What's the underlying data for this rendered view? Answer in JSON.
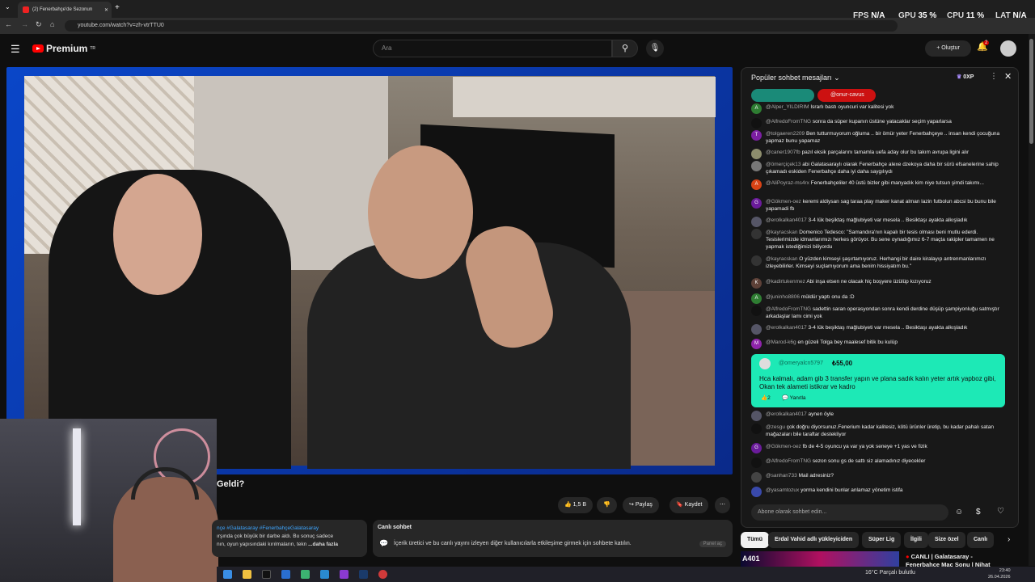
{
  "browser": {
    "tab_title": "(2) Fenerbahçe'de Sezonun",
    "url": "youtube.com/watch?v=zh-vtrTTU0",
    "perf": {
      "fps_label": "FPS",
      "fps": "N/A",
      "gpu_label": "GPU",
      "gpu": "35 %",
      "cpu_label": "CPU",
      "cpu": "11 %",
      "lat_label": "LAT",
      "lat": "N/A"
    }
  },
  "header": {
    "logo": "Premium",
    "logo_sup": "TR",
    "search_placeholder": "Ara",
    "create_label": "Oluştur",
    "notif_count": "2"
  },
  "video": {
    "title_fragment": "Geldi?",
    "like_count": "1,5 B",
    "share_label": "Paylaş",
    "save_label": "Kaydet"
  },
  "description": {
    "tags": "nçe #Galatasaray #FenerbahçeGalatasaray",
    "line1": "ırşında çok büyük bir darbe aldı. Bu sonuç sadece",
    "line2": "nın, oyun yapısındaki kırılmaların, tekn",
    "more": "...daha fazla"
  },
  "live_chat_card": {
    "title": "Canlı sohbet",
    "body": "İçerik üretici ve bu canlı yayını izleyen diğer kullanıcılarla etkileşime girmek için sohbete katılın.",
    "button": "Panel aç"
  },
  "chat": {
    "title": "Popüler sohbet mesajları",
    "xp": "0XP",
    "pinned_user": "@onur-cavus",
    "messages": [
      {
        "name": "@Alper_YILDIRIM",
        "text": "Israrlı bastı oyuncuri var kalitesi yok",
        "color": "#2e7d32",
        "initial": "A"
      },
      {
        "name": "@AlfredoFromTNG",
        "text": "sonra da süper kupanın üstüne yatacaklar seçim yaparlarsa",
        "color": "#111",
        "initial": ""
      },
      {
        "name": "@tolgaeren2209",
        "text": "Ben tutturmuyorum oğluma .. bir ömür yeter Fenerbahçeye .. insan kendi çocuğuna yapmaz bunu yapamaz",
        "color": "#7b1fa2",
        "initial": "T"
      },
      {
        "name": "@caner1907fb",
        "text": "pazıl eksik parçalarını tamamla uefa aday olur bu takım avrupa ligini alır",
        "color": "#8d8d6d",
        "initial": ""
      },
      {
        "name": "@ömerçiçek13",
        "text": "abi Galatasaraylı olarak Fenerbahçe alexe dzekoya daha bir sürü efsanelerine sahip çıkamadı eskiden Fenerbahçe daha iyi daha saygılıydı",
        "color": "#777",
        "initial": ""
      },
      {
        "name": "@AliPoyraz-ms4rx",
        "text": "Fenerbahçeliler 40 üstü bizler gibi manyadık kim niye tutsun şimdi takımı...",
        "color": "#d84315",
        "initial": "A"
      },
      {
        "name": "@Gökmen-oez",
        "text": "keremi aldiysan sag taraa play maker kanat alman lazin futbolun abcsi bu bunu bile yapamadi fb",
        "color": "#6a1b9a",
        "initial": "G"
      },
      {
        "name": "@erolkalkan4017",
        "text": "3-4 lük beşiktaş mağlubiyeti var mesela .. Besiktaşı ayakta alkışladık",
        "color": "#556",
        "initial": ""
      },
      {
        "name": "@kayracskan",
        "text": "Domenico Tedesco: \"Samandıra'nın kapalı bir tesis olması beni mutlu ederdi. Tesislerimizde idmanlarımızı herkes görüyor. Bu sene oynadığımız 6-7 maçta rakipler tamamen ne yapmak istediğimizi biliyordu",
        "color": "#333",
        "initial": ""
      },
      {
        "name": "@kayracskan",
        "text": "O yüzden kimseyi şaşırtamıyoruz. Herhangi bir daire kiralayıp antrenmanlarımızı izleyebilirler. Kimseyi suçlamıyorum ama benim hissiyatım bu.\"",
        "color": "#333",
        "initial": ""
      },
      {
        "name": "@kadirtukenmez",
        "text": "Abi inşa etsen ne olacak hiç boşyere üzülüp kızıyoruz",
        "color": "#5d4037",
        "initial": "K"
      },
      {
        "name": "@juninho8806",
        "text": "müldür yaptı onu da :D",
        "color": "#2e7d32",
        "initial": "A"
      },
      {
        "name": "@AlfredoFromTNG",
        "text": "sadettin saran operasyondan sonra kendi derdine düşüp şampiyonluğu satmıştır arkadaşlar lamı cimi yok",
        "color": "#111",
        "initial": ""
      },
      {
        "name": "@erolkalkan4017",
        "text": "3-4 lük beşiktaş mağlubiyeti var mesela .. Besiktaşı ayakta alkışladık",
        "color": "#556",
        "initial": ""
      },
      {
        "name": "@Marod-k6g",
        "text": "en güzeli Tolga bey maalesef bitik bu kulüp",
        "color": "#8e24aa",
        "initial": "M"
      }
    ],
    "superchat": {
      "name": "@omeryalcn5797",
      "amount": "₺55,00",
      "text": "Hca kalmalı, adam gib 3 transfer yapın ve plana sadık kalın yeter artık yapboz gibi, Okan tek alameti istikrar ve kadro",
      "likes": "2",
      "reply": "Yanıtla"
    },
    "messages_after": [
      {
        "name": "@erolkalkan4017",
        "text": "aynen öyle",
        "color": "#556",
        "initial": ""
      },
      {
        "name": "@zesgu",
        "text": "çok doğru diyorsunuz.Fenerium kadar kalitesiz, kötü ürünler üretip, bu kadar pahalı satan mağazaları bile taraftar destekliyor",
        "color": "#111",
        "initial": ""
      },
      {
        "name": "@Gökmen-oez",
        "text": "fb de 4-5 oyuncu ya var ya yok seneye +1 yas ve fizik",
        "color": "#6a1b9a",
        "initial": "G"
      },
      {
        "name": "@AlfredoFromTNG",
        "text": "sezon sonu gs de sattı siz alamadınız diyecekler",
        "color": "#111",
        "initial": ""
      },
      {
        "name": "@sanhan733",
        "text": "Mail adresiniz?",
        "color": "#444",
        "initial": ""
      },
      {
        "name": "@yasamtozux",
        "text": "yorma kendini bunlar anlamaz yönetim istifa",
        "color": "#3949ab",
        "initial": ""
      }
    ],
    "input_placeholder": "Abone olarak sohbet edin..."
  },
  "chips": [
    "Tümü",
    "Erdal Vahid adlı yükleyiciden",
    "Süper Lig",
    "İlgili",
    "Size özel",
    "Canlı"
  ],
  "recommendation": {
    "thumb_text": "A401",
    "title": "CANLI | Galatasaray - Fenerbahçe Maç Sonu | Nihat"
  },
  "taskbar": {
    "weather": "16°C  Parçalı bulutlu",
    "time": "23:40",
    "date": "26.04.2026"
  }
}
